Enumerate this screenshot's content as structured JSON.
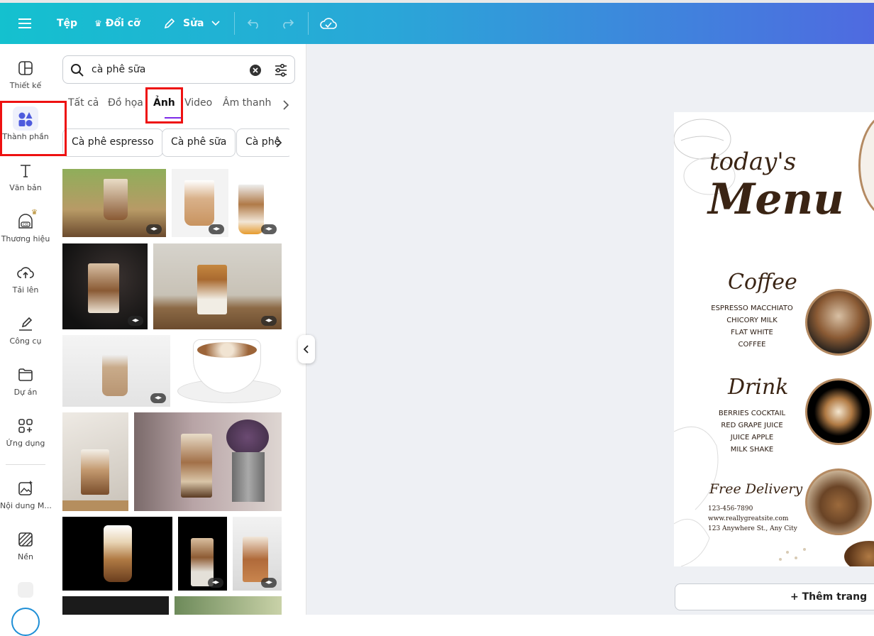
{
  "topbar": {
    "file_label": "Tệp",
    "resize_label": "Đổi cỡ",
    "edit_label": "Sửa"
  },
  "sidebar": {
    "items": [
      {
        "label": "Thiết kế",
        "icon": "layout-icon"
      },
      {
        "label": "Thành phần",
        "icon": "elements-icon"
      },
      {
        "label": "Văn bản",
        "icon": "text-icon"
      },
      {
        "label": "Thương hiệu",
        "icon": "brand-icon"
      },
      {
        "label": "Tải lên",
        "icon": "upload-cloud-icon"
      },
      {
        "label": "Công cụ",
        "icon": "draw-icon"
      },
      {
        "label": "Dự án",
        "icon": "folder-icon"
      },
      {
        "label": "Ứng dụng",
        "icon": "apps-icon"
      },
      {
        "label": "Nội dung M...",
        "icon": "magic-media-icon"
      },
      {
        "label": "Nền",
        "icon": "background-icon"
      }
    ]
  },
  "search": {
    "value": "cà phê sữa"
  },
  "tabs": [
    {
      "label": "Tất cả"
    },
    {
      "label": "Đồ họa"
    },
    {
      "label": "Ảnh"
    },
    {
      "label": "Video"
    },
    {
      "label": "Âm thanh"
    }
  ],
  "chips": [
    {
      "label": "Cà phê espresso"
    },
    {
      "label": "Cà phê sữa"
    },
    {
      "label": "Cà phê"
    }
  ],
  "menu_design": {
    "todays": "today's",
    "menu": "Menu",
    "coffee_title": "Coffee",
    "coffee_items": [
      "ESPRESSO MACCHIATO",
      "CHICORY MILK",
      "FLAT WHITE",
      "COFFEE"
    ],
    "drink_title": "Drink",
    "drink_items": [
      "BERRIES COCKTAIL",
      "RED GRAPE JUICE",
      "JUICE APPLE",
      "MILK SHAKE"
    ],
    "delivery_title": "Free Delivery",
    "phone": "123-456-7890",
    "site": "www.reallygreatsite.com",
    "address": "123 Anywhere St., Any City"
  },
  "add_page_label": "+ Thêm trang",
  "colors": {
    "accent": "#7d2ae8",
    "highlight": "#e11111",
    "menu_brown": "#3a2414"
  }
}
